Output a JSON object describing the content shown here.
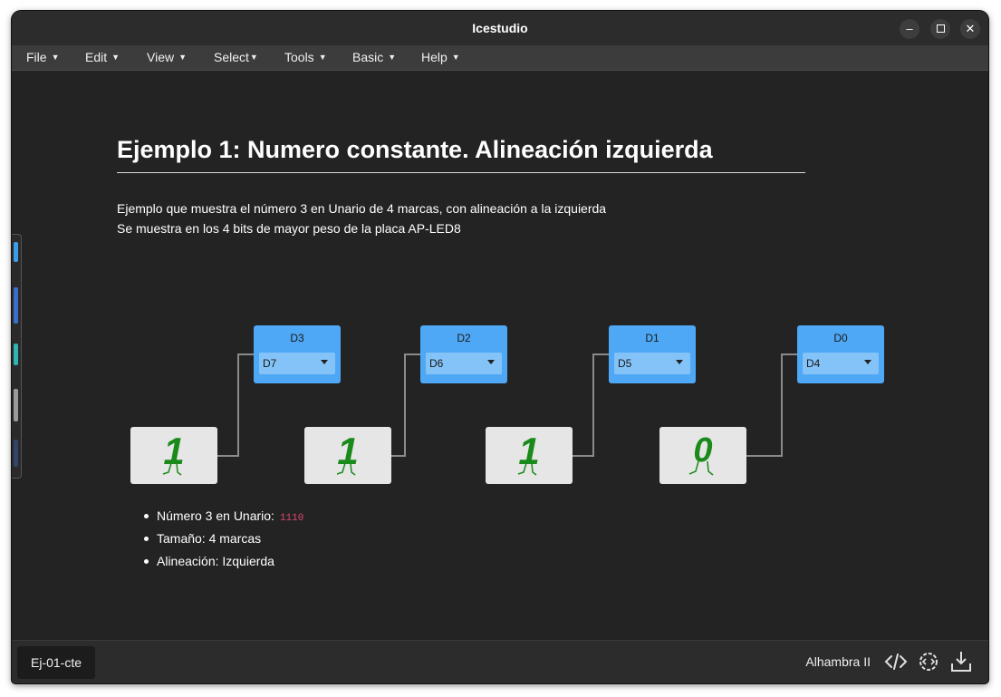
{
  "window": {
    "title": "Icestudio"
  },
  "menu": [
    {
      "label": "File"
    },
    {
      "label": "Edit"
    },
    {
      "label": "View"
    },
    {
      "label": "Select"
    },
    {
      "label": "Tools"
    },
    {
      "label": "Basic"
    },
    {
      "label": "Help"
    }
  ],
  "doc": {
    "heading": "Ejemplo 1: Numero constante. Alineación izquierda",
    "line1": "Ejemplo que muestra el número 3 en Unario de 4 marcas, con alineación a la izquierda",
    "line2": "Se muestra en los 4 bits de mayor peso de la placa AP-LED8"
  },
  "outputs": [
    {
      "name": "D3",
      "pin": "D7"
    },
    {
      "name": "D2",
      "pin": "D6"
    },
    {
      "name": "D1",
      "pin": "D5"
    },
    {
      "name": "D0",
      "pin": "D4"
    }
  ],
  "constants": [
    {
      "value": "1"
    },
    {
      "value": "1"
    },
    {
      "value": "1"
    },
    {
      "value": "0"
    }
  ],
  "notes": {
    "item1": "Número 3 en Unario:",
    "item1_code": "1110",
    "item2": "Tamaño: 4 marcas",
    "item3": "Alineación: Izquierda"
  },
  "status": {
    "tab": "Ej-01-cte",
    "board": "Alhambra II",
    "icons": [
      "code-icon",
      "gear-code-icon",
      "download-icon"
    ]
  },
  "colors": {
    "output_block": "#4fa8f5",
    "pin_select": "#84c3f7",
    "constant_block": "#e6e6e6",
    "digit": "#1a8a1a",
    "code": "#d7476d"
  }
}
